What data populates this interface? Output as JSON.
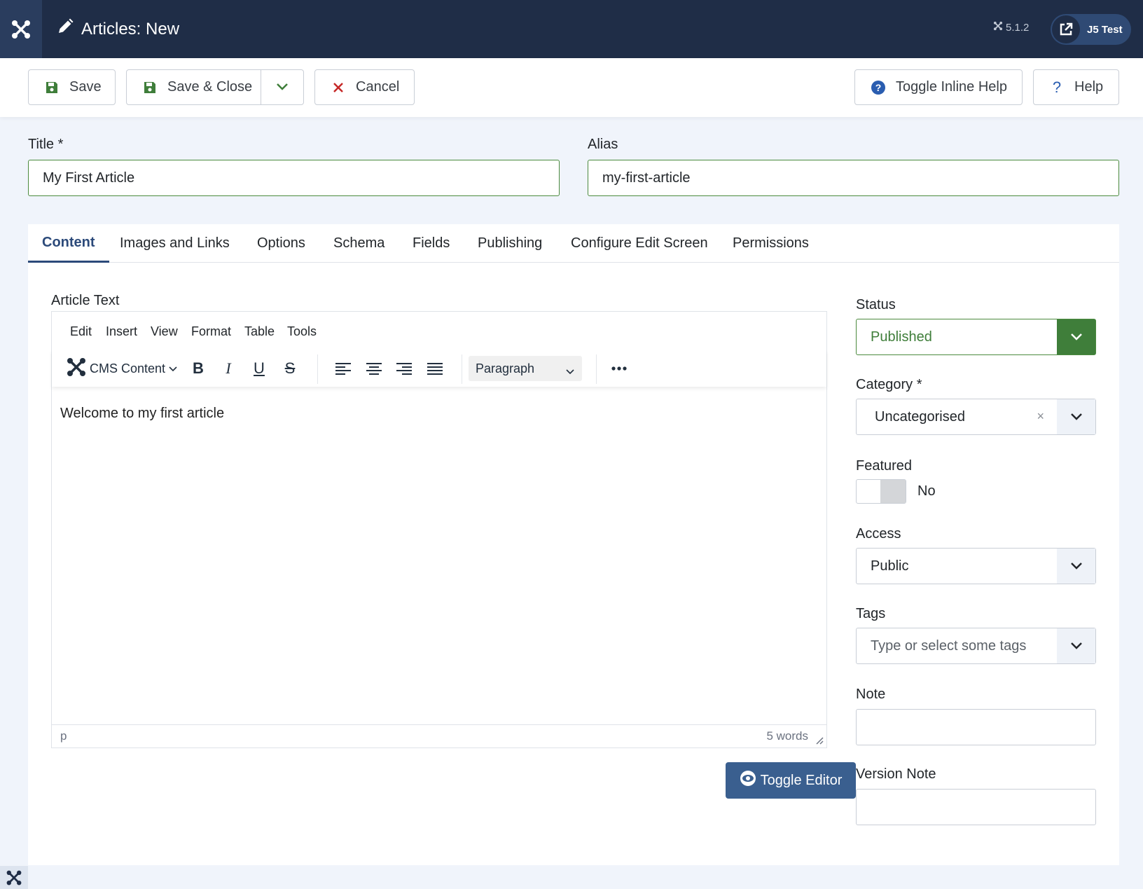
{
  "header": {
    "title": "Articles: New",
    "version": "5.1.2",
    "site_button": "J5 Test"
  },
  "toolbar": {
    "save": "Save",
    "save_close": "Save & Close",
    "cancel": "Cancel",
    "toggle_inline_help": "Toggle Inline Help",
    "help": "Help"
  },
  "fields": {
    "title_label": "Title *",
    "title_value": "My First Article",
    "alias_label": "Alias",
    "alias_value": "my-first-article"
  },
  "tabs": [
    "Content",
    "Images and Links",
    "Options",
    "Schema",
    "Fields",
    "Publishing",
    "Configure Edit Screen",
    "Permissions"
  ],
  "editor": {
    "label": "Article Text",
    "menu": [
      "Edit",
      "Insert",
      "View",
      "Format",
      "Table",
      "Tools"
    ],
    "cms_content": "CMS Content",
    "block_format": "Paragraph",
    "body_text": "Welcome to my first article",
    "path": "p",
    "word_count": "5 words",
    "toggle_editor": "Toggle Editor"
  },
  "sidebar": {
    "status_label": "Status",
    "status_value": "Published",
    "category_label": "Category *",
    "category_value": "Uncategorised",
    "category_clear": "×",
    "featured_label": "Featured",
    "featured_value": "No",
    "access_label": "Access",
    "access_value": "Public",
    "tags_label": "Tags",
    "tags_placeholder": "Type or select some tags",
    "note_label": "Note",
    "version_note_label": "Version Note"
  },
  "colors": {
    "header_bg": "#1f2d47",
    "accent": "#2c4a7a",
    "success": "#4b8a3e",
    "danger": "#c52827"
  }
}
